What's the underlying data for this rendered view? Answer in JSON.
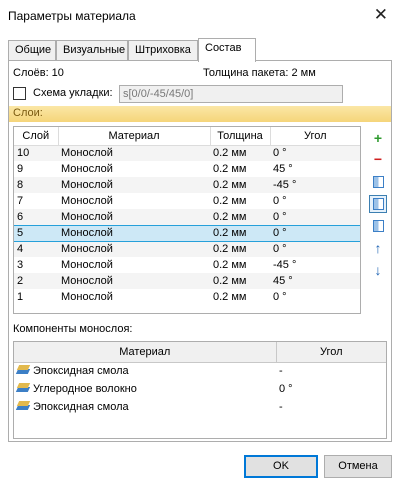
{
  "window": {
    "title": "Параметры материала",
    "close_glyph": "✕"
  },
  "tabs": [
    {
      "label": "Общие"
    },
    {
      "label": "Визуальные"
    },
    {
      "label": "Штриховка"
    },
    {
      "label": "Состав"
    }
  ],
  "summary": {
    "layers_count": "Слоёв: 10",
    "thickness": "Толщина пакета: 2 мм",
    "layup_label": "Схема укладки:",
    "layup_checked": false,
    "layup_value": "s[0/0/-45/45/0]"
  },
  "layers_section": "Слои:",
  "layers_table": {
    "columns": [
      "Слой",
      "Материал",
      "Толщина",
      "Угол"
    ],
    "selected_index": 5,
    "rows": [
      {
        "layer": "10",
        "material": "Монослой",
        "thickness": "0.2 мм",
        "angle": "0 °"
      },
      {
        "layer": "9",
        "material": "Монослой",
        "thickness": "0.2 мм",
        "angle": "45 °"
      },
      {
        "layer": "8",
        "material": "Монослой",
        "thickness": "0.2 мм",
        "angle": "-45 °"
      },
      {
        "layer": "7",
        "material": "Монослой",
        "thickness": "0.2 мм",
        "angle": "0 °"
      },
      {
        "layer": "6",
        "material": "Монослой",
        "thickness": "0.2 мм",
        "angle": "0 °"
      },
      {
        "layer": "5",
        "material": "Монослой",
        "thickness": "0.2 мм",
        "angle": "0 °"
      },
      {
        "layer": "4",
        "material": "Монослой",
        "thickness": "0.2 мм",
        "angle": "0 °"
      },
      {
        "layer": "3",
        "material": "Монослой",
        "thickness": "0.2 мм",
        "angle": "-45 °"
      },
      {
        "layer": "2",
        "material": "Монослой",
        "thickness": "0.2 мм",
        "angle": "45 °"
      },
      {
        "layer": "1",
        "material": "Монослой",
        "thickness": "0.2 мм",
        "angle": "0 °"
      }
    ]
  },
  "side_buttons": [
    {
      "name": "add-layer-button",
      "icon": "plus-icon",
      "glyph": "+",
      "color": "#2e9a2e"
    },
    {
      "name": "remove-layer-button",
      "icon": "minus-icon",
      "glyph": "−",
      "color": "#d02020"
    },
    {
      "name": "layer-view-button",
      "icon": "book-icon",
      "glyph": "",
      "color": "#3c7fc6"
    },
    {
      "name": "layer-mirror-button",
      "icon": "book-open-icon",
      "glyph": "",
      "color": "#3c7fc6"
    },
    {
      "name": "layer-copy-button",
      "icon": "copy-icon",
      "glyph": "",
      "color": "#3c7fc6"
    },
    {
      "name": "move-up-button",
      "icon": "arrow-up-icon",
      "glyph": "↑",
      "color": "#1f64b4"
    },
    {
      "name": "move-down-button",
      "icon": "arrow-down-icon",
      "glyph": "↓",
      "color": "#1f64b4"
    }
  ],
  "components_section": "Компоненты монослоя:",
  "components_table": {
    "columns": [
      "Материал",
      "Угол"
    ],
    "rows": [
      {
        "material": "Эпоксидная смола",
        "angle": "-"
      },
      {
        "material": "Углеродное волокно",
        "angle": "0 °"
      },
      {
        "material": "Эпоксидная смола",
        "angle": "-"
      }
    ]
  },
  "buttons": {
    "ok": "OK",
    "cancel": "Отмена"
  }
}
